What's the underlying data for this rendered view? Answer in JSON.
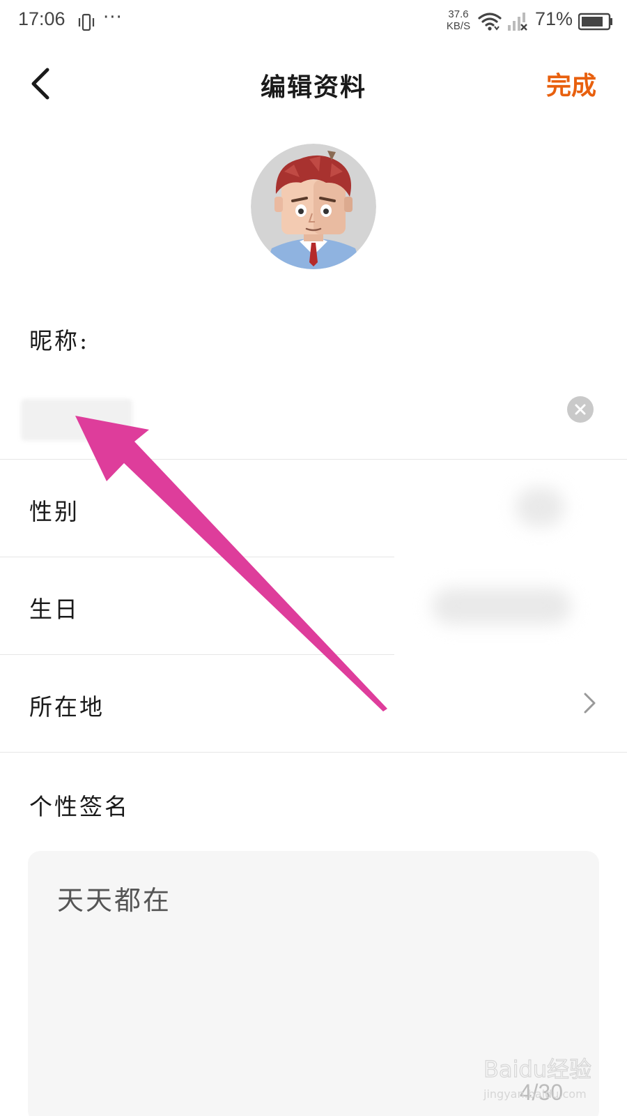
{
  "status_bar": {
    "time": "17:06",
    "dots": "···",
    "net_speed": "37.6",
    "net_unit": "KB/S",
    "battery": "71%"
  },
  "header": {
    "back_icon": "chevron-left-icon",
    "title": "编辑资料",
    "done_label": "完成",
    "done_color": "#e8600e"
  },
  "profile": {
    "nickname_label": "昵称:",
    "gender_label": "性别",
    "birthday_label": "生日",
    "location_label": "所在地",
    "bio_label": "个性签名",
    "bio_value": "天天都在",
    "bio_count": "4/30"
  },
  "watermark": {
    "brand": "Baidu经验",
    "url": "jingyan.baidu.com"
  },
  "annotation": {
    "arrow_color": "#de3d9b"
  }
}
